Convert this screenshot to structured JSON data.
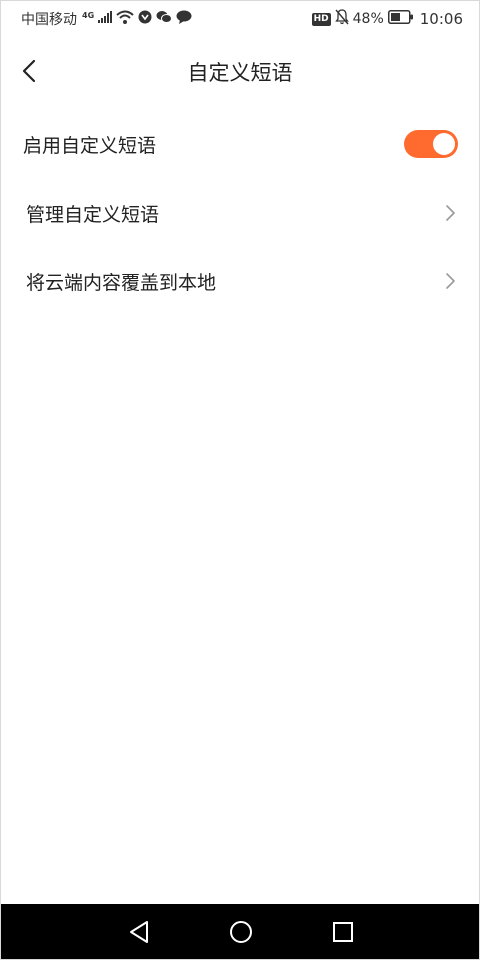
{
  "status_bar": {
    "carrier": "中国移动",
    "network_gen": "4G",
    "hd_badge": "HD",
    "battery": "48%",
    "time": "10:06",
    "icons": [
      "signal-icon",
      "wifi-icon",
      "app-notification-icon",
      "wechat-icon",
      "message-icon",
      "mute-bell-icon",
      "battery-icon"
    ]
  },
  "header": {
    "title": "自定义短语",
    "back_icon": "chevron-left-icon"
  },
  "settings": {
    "enable_label": "启用自定义短语",
    "enable_on": true,
    "manage_label": "管理自定义短语",
    "overwrite_label": "将云端内容覆盖到本地"
  },
  "colors": {
    "accent": "#FF6A2F",
    "text": "#222222",
    "chevron": "#9a9a9a",
    "nav_bar": "#000000"
  },
  "system_nav": {
    "icons": [
      "back-triangle-icon",
      "home-circle-icon",
      "recents-square-icon"
    ]
  }
}
